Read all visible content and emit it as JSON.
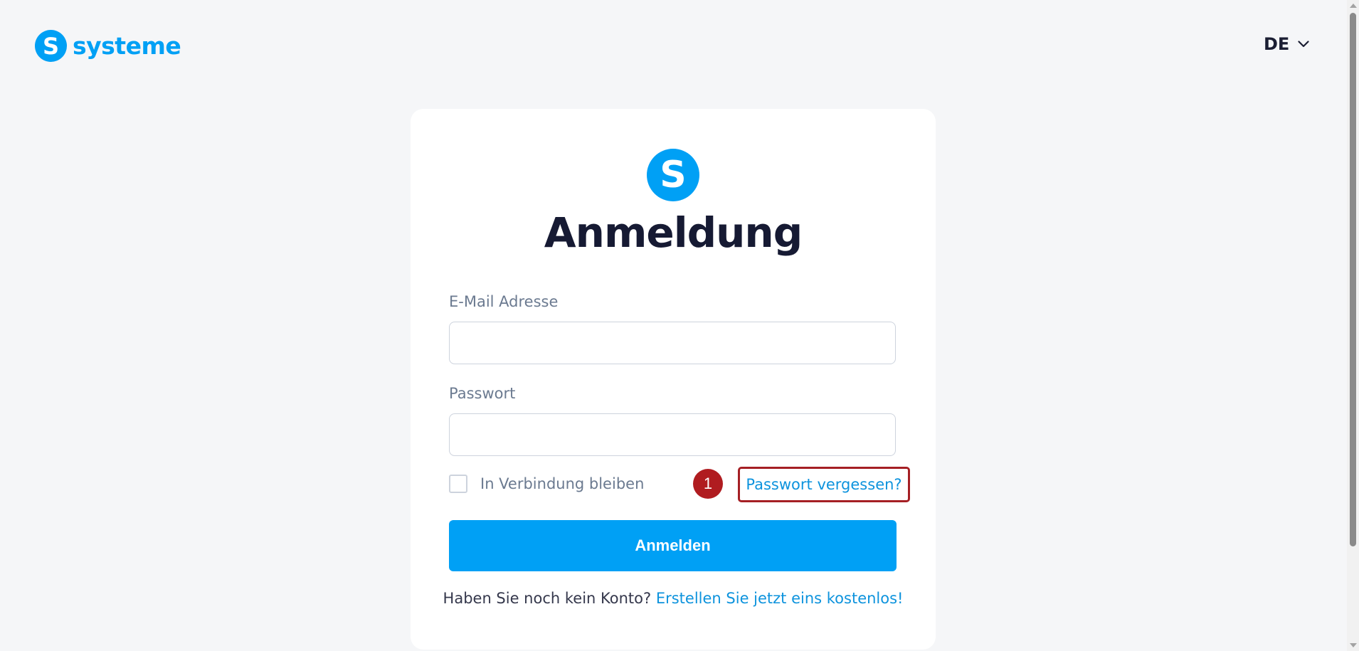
{
  "header": {
    "brand_letter": "S",
    "brand_name": "systeme",
    "language": "DE"
  },
  "login_card": {
    "logo_letter": "S",
    "title": "Anmeldung",
    "email_label": "E-Mail Adresse",
    "email_value": "",
    "password_label": "Passwort",
    "password_value": "",
    "remember_me_label": "In Verbindung bleiben",
    "remember_me_checked": false,
    "forgot_password_link": "Passwort vergessen?",
    "submit_label": "Anmelden",
    "signup_prompt": "Haben Sie noch kein Konto?",
    "signup_link": "Erstellen Sie jetzt eins kostenlos!"
  },
  "annotation": {
    "marker_number": "1"
  },
  "colors": {
    "brand_blue": "#00a0f5",
    "link_blue": "#0d93dd",
    "annotation_red": "#b01c20",
    "title_dark": "#161a33",
    "page_background": "#f5f6f8"
  },
  "icons": {
    "language_dropdown": "chevron-down-icon"
  }
}
